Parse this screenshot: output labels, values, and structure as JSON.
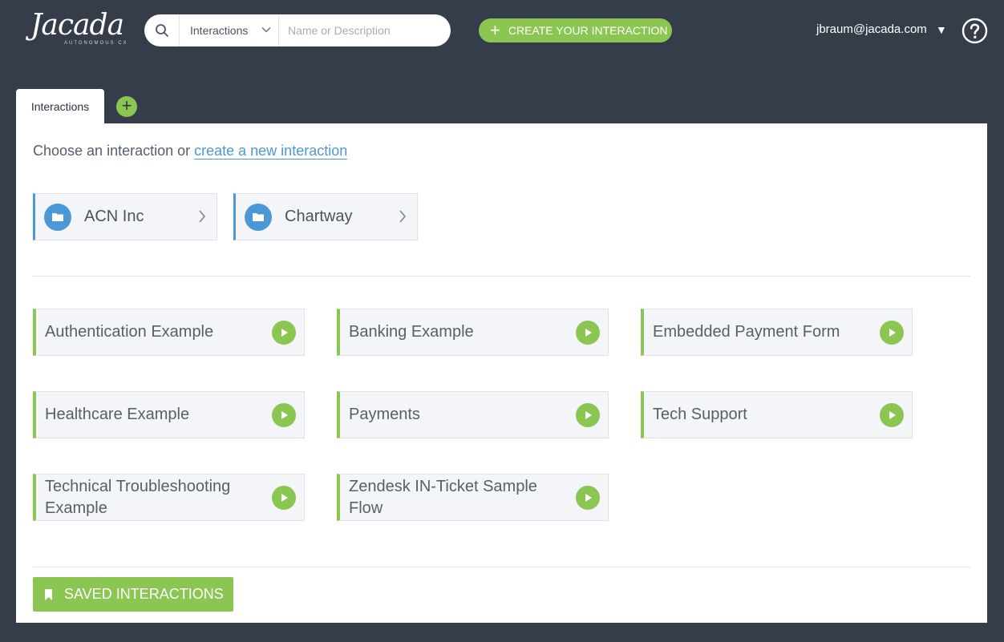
{
  "header": {
    "logo_text": "Jacada",
    "logo_subtext": "AUTONOMOUS CX",
    "search": {
      "scope_value": "Interactions",
      "placeholder": "Name or Description"
    },
    "create_button_label": "CREATE YOUR INTERACTION",
    "user_email": "jbraum@jacada.com",
    "user_caret": "▼"
  },
  "tabs": [
    {
      "label": "Interactions",
      "active": true
    }
  ],
  "main": {
    "intro_text": "Choose an interaction or ",
    "intro_link": "create a new interaction",
    "folders": [
      {
        "label": "ACN Inc"
      },
      {
        "label": "Chartway"
      }
    ],
    "interactions": [
      {
        "label": "Authentication Example"
      },
      {
        "label": "Banking Example"
      },
      {
        "label": "Embedded Payment Form"
      },
      {
        "label": "Healthcare Example"
      },
      {
        "label": "Payments"
      },
      {
        "label": "Tech Support"
      },
      {
        "label": "Technical Troubleshooting Example"
      },
      {
        "label": "Zendesk IN-Ticket Sample Flow"
      }
    ],
    "saved_button_label": "SAVED INTERACTIONS"
  },
  "colors": {
    "background": "#353d4a",
    "accent_green": "#8bc552",
    "accent_blue": "#4a98d6",
    "card_bg": "#f4f5f8"
  },
  "icons": {
    "search": "search-icon",
    "chevron_down": "chevron-down-icon",
    "plus": "plus-icon",
    "help": "help-icon",
    "folder": "folder-icon",
    "chevron_right": "chevron-right-icon",
    "play": "play-icon",
    "bookmark": "bookmark-icon"
  }
}
